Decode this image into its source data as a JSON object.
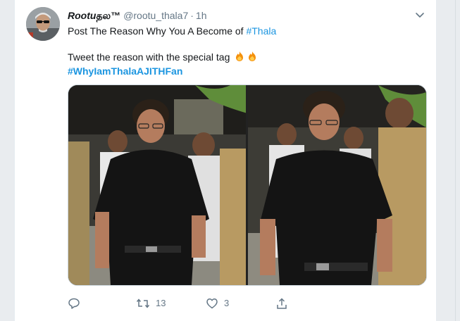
{
  "tweet": {
    "display_name_stylized": "Rootu",
    "display_name_tamil": "தல",
    "display_name_mark": "™",
    "handle": "@rootu_thala7",
    "separator": "·",
    "time": "1h",
    "line1_text": "Post The Reason Why You A Become of ",
    "line1_hashtag": "#Thala",
    "line2_text": "Tweet the reason with the special tag ",
    "line3_hashtag": "#WhyIamThalaAJITHFan",
    "emoji": [
      "fire-icon",
      "fire-icon"
    ],
    "media_alt": "photo"
  },
  "actions": {
    "reply_icon": "reply-icon",
    "retweet_icon": "retweet-icon",
    "retweet_count": "13",
    "like_icon": "heart-icon",
    "like_count": "3",
    "share_icon": "share-icon"
  },
  "colors": {
    "link": "#1b95e0",
    "text": "#14171a",
    "muted": "#657786",
    "border": "#e6ecf0",
    "page_bg": "#e9ecef"
  }
}
